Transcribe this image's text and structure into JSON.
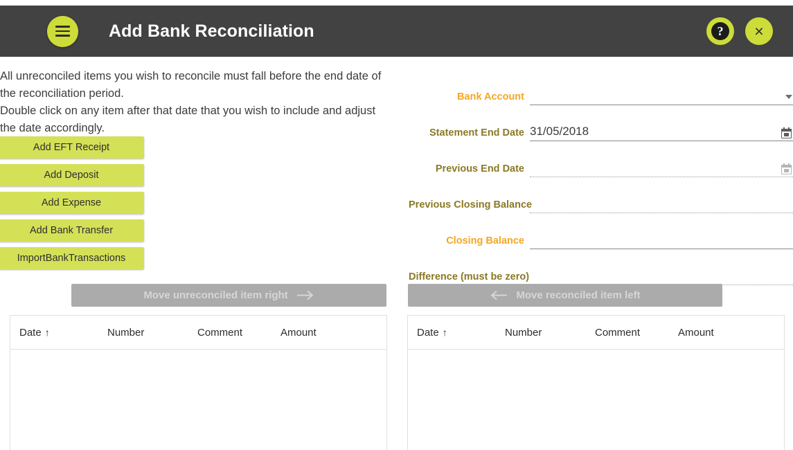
{
  "header": {
    "title": "Add Bank Reconciliation",
    "menu_icon": "hamburger-icon",
    "help_label": "?",
    "close_label": "×",
    "background": "#424242",
    "accent": "#cddc39"
  },
  "instructions": {
    "line1": "All unreconciled items you wish to reconcile must fall before the end date of",
    "line2": "the reconciliation period.",
    "line3": "Double click on any item after that date that you wish to include and adjust",
    "line4": "the date accordingly."
  },
  "action_buttons": [
    {
      "label": "Add EFT Receipt"
    },
    {
      "label": "Add Deposit"
    },
    {
      "label": "Add Expense"
    },
    {
      "label": "Add Bank Transfer"
    },
    {
      "label": "ImportBankTransactions"
    }
  ],
  "form": {
    "active_label_color": "#f5a623",
    "muted_label_color": "#8a7a25",
    "fields": [
      {
        "label": "Bank Account",
        "value": "",
        "state": "active",
        "control": "dropdown",
        "underline": "solid"
      },
      {
        "label": "Statement End Date",
        "value": "31/05/2018",
        "state": "muted",
        "control": "calendar",
        "underline": "solid"
      },
      {
        "label": "Previous End Date",
        "value": "",
        "state": "muted",
        "control": "calendar-disabled",
        "underline": "dotted"
      },
      {
        "label": "Previous Closing Balance",
        "value": "",
        "state": "muted",
        "control": "none",
        "underline": "dotted"
      },
      {
        "label": "Closing Balance",
        "value": "",
        "state": "active",
        "control": "none",
        "underline": "solid"
      },
      {
        "label": "Difference (must be zero)",
        "value": "",
        "state": "muted",
        "control": "none",
        "underline": "dotted"
      }
    ]
  },
  "move_buttons": {
    "right": {
      "label": "Move unreconciled item right",
      "icon": "arrow-right-icon",
      "disabled": true
    },
    "left": {
      "label": "Move reconciled item left",
      "icon": "arrow-left-icon",
      "disabled": true
    }
  },
  "tables": {
    "columns": [
      "Date",
      "Number",
      "Comment",
      "Amount"
    ],
    "sort_indicator": "↑",
    "left": {
      "rows": []
    },
    "right": {
      "rows": []
    }
  }
}
